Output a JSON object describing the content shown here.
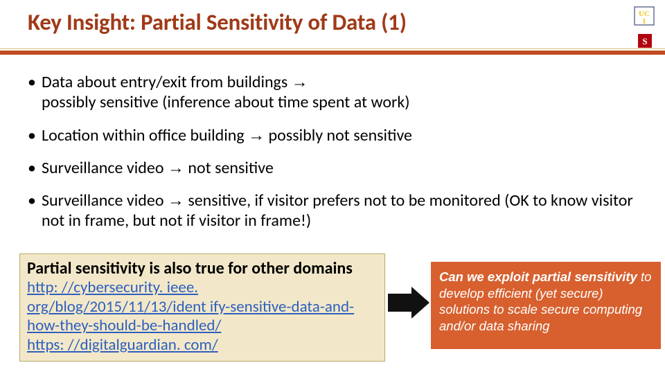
{
  "header": {
    "title": "Key Insight: Partial Sensitivity of Data (1)"
  },
  "bullets": {
    "b1a": "Data about entry/exit from buildings ",
    "b1b": " possibly sensitive (inference about time spent at work)",
    "b2a": "Location within office building ",
    "b2b": " possibly not sensitive",
    "b3a": "Surveillance video ",
    "b3b": "  not sensitive",
    "b4a": "Surveillance video ",
    "b4b": " sensitive, if visitor prefers not to be monitored (OK to know visitor not in frame, but not if visitor in frame!)"
  },
  "arrow_glyph": "→",
  "callout": {
    "line": "Partial sensitivity is also true for other domains",
    "link1": "http: //cybersecurity. ieee. org/blog/2015/11/13/ident ify-sensitive-data-and-how-they-should-be-handled/",
    "link2": "https: //digitalguardian. com/"
  },
  "orange": {
    "l1": "Can we exploit partial sensitivity",
    "l2": "to develop efficient (yet secure) solutions to scale secure computing and/or data sharing"
  },
  "logos": {
    "uci": "uci-logo",
    "stanford": "stanford-logo"
  }
}
